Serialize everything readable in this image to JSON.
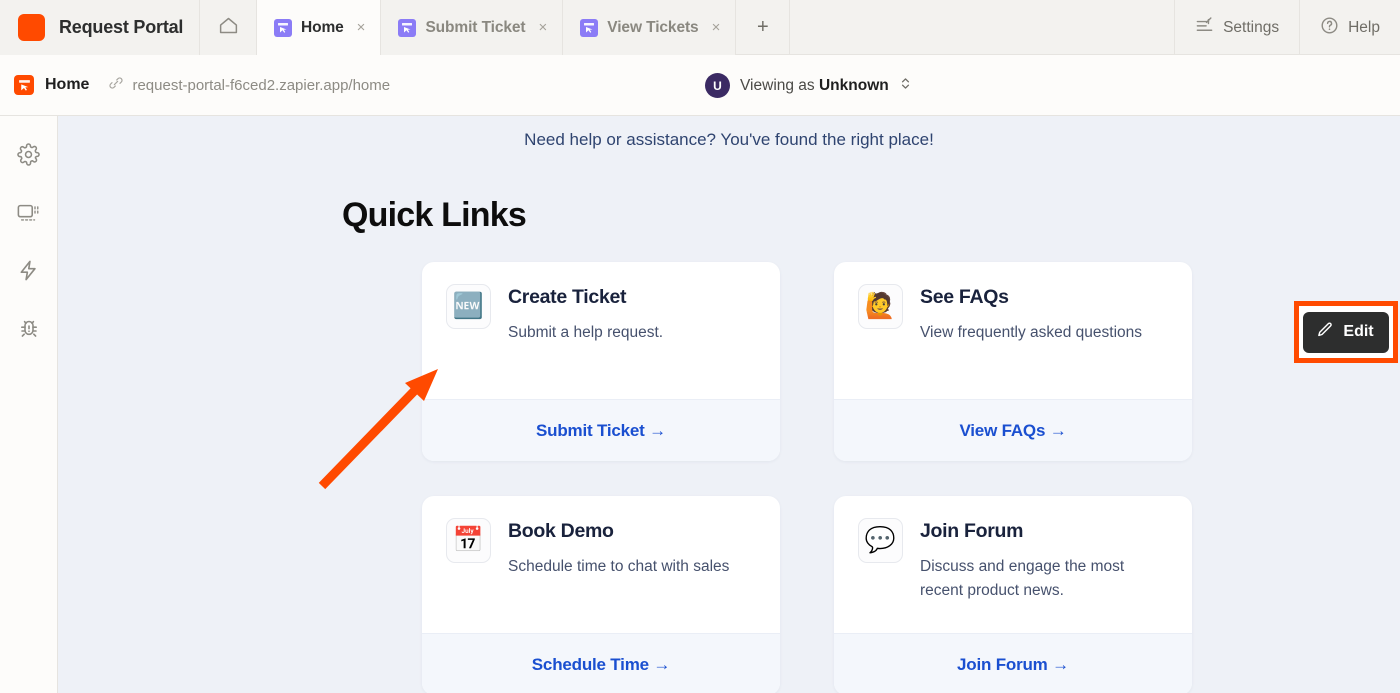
{
  "app": {
    "brand_title": "Request Portal",
    "logo_color": "#ff4a00",
    "accent_blue": "#1a4fd0",
    "annotation_color": "#ff4a00"
  },
  "tabbar": {
    "home_icon": "home-icon",
    "tabs": [
      {
        "label": "Home",
        "icon": "app-favicon-purple",
        "active": true,
        "close_glyph": "×"
      },
      {
        "label": "Submit Ticket",
        "icon": "app-favicon-purple",
        "active": false,
        "close_glyph": "×"
      },
      {
        "label": "View Tickets",
        "icon": "app-favicon-purple",
        "active": false,
        "close_glyph": "×"
      }
    ],
    "new_tab_glyph": "+",
    "settings_label": "Settings",
    "settings_icon": "sliders-icon",
    "help_label": "Help",
    "help_icon": "question-circle-icon"
  },
  "urlbar": {
    "page_name": "Home",
    "favicon": "app-favicon-orange",
    "link_icon": "link-icon",
    "url": "request-portal-f6ced2.zapier.app/home",
    "viewing_prefix": "Viewing as ",
    "viewing_user": "Unknown",
    "avatar_initial": "U",
    "selector_icon": "chevron-up-down-icon"
  },
  "rail": {
    "items": [
      {
        "icon": "gear-icon"
      },
      {
        "icon": "screen-layout-icon"
      },
      {
        "icon": "lightning-bolt-icon"
      },
      {
        "icon": "bug-icon"
      }
    ]
  },
  "main": {
    "tagline": "Need help or assistance? You've found the right place!",
    "section_title": "Quick Links",
    "edit_label": "Edit",
    "edit_icon": "pencil-icon",
    "cards": [
      {
        "emoji": "🆕",
        "emoji_name": "new-button-emoji",
        "title": "Create Ticket",
        "description": "Submit a help request.",
        "link_label": "Submit Ticket →"
      },
      {
        "emoji": "🙋",
        "emoji_name": "person-raising-hand-emoji",
        "title": "See FAQs",
        "description": "View frequently asked questions",
        "link_label": "View FAQs →"
      },
      {
        "emoji": "📅",
        "emoji_name": "calendar-emoji",
        "title": "Book Demo",
        "description": "Schedule time to chat with sales",
        "link_label": "Schedule Time →"
      },
      {
        "emoji": "💬",
        "emoji_name": "speech-balloon-emoji",
        "title": "Join Forum",
        "description": "Discuss and engage the most recent product news.",
        "link_label": "Join Forum →"
      }
    ]
  }
}
